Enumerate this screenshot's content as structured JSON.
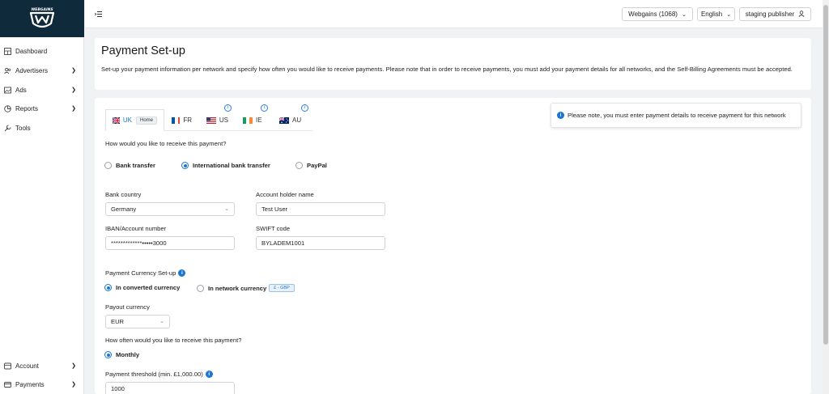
{
  "app": {
    "logo_text": "WEBGAINS"
  },
  "sidebar": {
    "items": [
      {
        "label": "Dashboard",
        "icon": "dashboard-icon",
        "chevron": false
      },
      {
        "label": "Advertisers",
        "icon": "users-icon",
        "chevron": true
      },
      {
        "label": "Ads",
        "icon": "image-icon",
        "chevron": true
      },
      {
        "label": "Reports",
        "icon": "pie-chart-icon",
        "chevron": true
      },
      {
        "label": "Tools",
        "icon": "wrench-icon",
        "chevron": false
      }
    ],
    "bottom_items": [
      {
        "label": "Account",
        "icon": "account-icon",
        "chevron": true
      },
      {
        "label": "Payments",
        "icon": "payments-icon",
        "chevron": true
      }
    ]
  },
  "topbar": {
    "network_selector": "Webgains (1068)",
    "language": "English",
    "user": "staging publisher"
  },
  "page": {
    "title": "Payment Set-up",
    "description": "Set-up your payment information per network and specify how often you would like to receive payments. Please note that in order to receive payments, you must add your payment details for all networks, and the Self-Billing Agreements must be accepted."
  },
  "tabs": [
    {
      "label": "UK",
      "badge": "Home",
      "active": true,
      "info": false
    },
    {
      "label": "FR",
      "active": false,
      "info": false
    },
    {
      "label": "US",
      "active": false,
      "info": true
    },
    {
      "label": "IE",
      "active": false,
      "info": true
    },
    {
      "label": "AU",
      "active": false,
      "info": true
    }
  ],
  "notice": {
    "text": "Please note, you must enter payment details to receive payment for this network"
  },
  "payment_method": {
    "question": "How would you like to receive this payment?",
    "options": [
      {
        "label": "Bank transfer",
        "selected": false
      },
      {
        "label": "International bank transfer",
        "selected": true
      },
      {
        "label": "PayPal",
        "selected": false
      }
    ]
  },
  "bank": {
    "country_label": "Bank country",
    "country_value": "Germany",
    "holder_label": "Account holder name",
    "holder_value": "Test User",
    "iban_label": "IBAN/Account number",
    "iban_value": "*************•••••3000",
    "swift_label": "SWIFT code",
    "swift_value": "BYLADEM1001"
  },
  "currency": {
    "setup_label": "Payment Currency Set-up",
    "options": [
      {
        "label": "In converted currency",
        "selected": true
      },
      {
        "label": "In network currency",
        "selected": false,
        "badge": "£ - GBP"
      }
    ],
    "payout_label": "Payout currency",
    "payout_value": "EUR"
  },
  "frequency": {
    "question": "How often would you like to receive this payment?",
    "option": "Monthly",
    "selected": true
  },
  "threshold": {
    "label": "Payment threshold (min. £1,000.00)",
    "value": "1000"
  },
  "colors": {
    "accent": "#1976d2",
    "sidebar_logo_bg": "#0f2a3a",
    "page_bg": "#f1f2f4"
  }
}
